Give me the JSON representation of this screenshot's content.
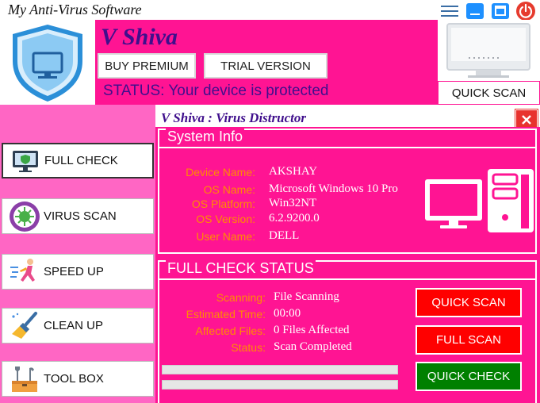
{
  "app": {
    "title": "My Anti-Virus Software",
    "window_buttons": [
      "menu-icon",
      "minimize-icon",
      "maximize-icon",
      "power-icon"
    ]
  },
  "header": {
    "brand": "V Shiva",
    "buy_premium": "BUY PREMIUM",
    "trial_version": "TRIAL VERSION",
    "status_label": "STATUS:",
    "status_value": "Your device is protected",
    "quick_scan": "QUICK SCAN"
  },
  "sidebar": {
    "items": [
      {
        "label": "FULL CHECK",
        "icon": "monitor-shield-icon"
      },
      {
        "label": "VIRUS SCAN",
        "icon": "virus-icon"
      },
      {
        "label": "SPEED UP",
        "icon": "runner-icon"
      },
      {
        "label": "CLEAN UP",
        "icon": "broom-icon"
      },
      {
        "label": "TOOL BOX",
        "icon": "toolbox-icon"
      }
    ]
  },
  "panel": {
    "title": "V Shiva : Virus Distructor",
    "system_info": {
      "heading": "System Info",
      "rows": [
        {
          "label": "Device Name:",
          "value": "AKSHAY"
        },
        {
          "label": "OS Name:",
          "value": "Microsoft Windows 10 Pro"
        },
        {
          "label": "OS Platform:",
          "value": "Win32NT"
        },
        {
          "label": "OS Version:",
          "value": "6.2.9200.0"
        },
        {
          "label": "User Name:",
          "value": "DELL"
        }
      ]
    },
    "full_check_status": {
      "heading": "FULL CHECK STATUS",
      "rows": [
        {
          "label": "Scanning:",
          "value": "File Scanning"
        },
        {
          "label": "Estimated Time:",
          "value": "00:00"
        },
        {
          "label": "Affected Files:",
          "value": "0 Files Affected"
        },
        {
          "label": "Status:",
          "value": "Scan Completed"
        }
      ],
      "progress": [
        0,
        0
      ]
    },
    "buttons": {
      "quick_scan": "QUICK SCAN",
      "full_scan": "FULL SCAN",
      "quick_check": "QUICK CHECK"
    }
  },
  "colors": {
    "accent_pink": "#ff1493",
    "sidebar_pink": "#ff66c4",
    "brand_purple": "#3f0f8c",
    "label_orange": "#ff8c00",
    "danger_red": "#ff0000",
    "ok_green": "#008000"
  }
}
